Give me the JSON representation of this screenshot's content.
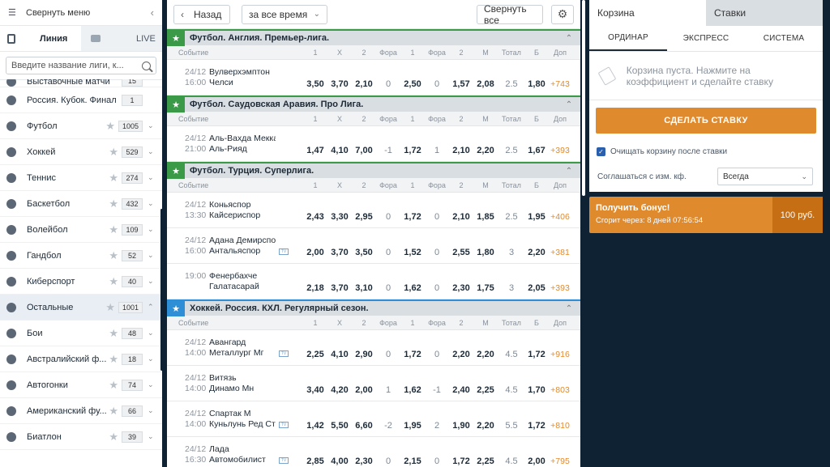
{
  "sidebar": {
    "collapse_label": "Свернуть меню",
    "tab_line": "Линия",
    "tab_live": "LIVE",
    "search_placeholder": "Введите название лиги, к...",
    "items": [
      {
        "name": "Выставочные матчи",
        "count": "15",
        "icon": "trophy-icon"
      },
      {
        "name": "Россия. Кубок. Финал",
        "count": "1",
        "icon": "trophy-icon"
      },
      {
        "name": "Футбол",
        "count": "1005",
        "icon": "soccer-ball-icon"
      },
      {
        "name": "Хоккей",
        "count": "529",
        "icon": "hockey-puck-icon"
      },
      {
        "name": "Теннис",
        "count": "274",
        "icon": "tennis-ball-icon"
      },
      {
        "name": "Баскетбол",
        "count": "432",
        "icon": "basketball-icon"
      },
      {
        "name": "Волейбол",
        "count": "109",
        "icon": "volleyball-icon"
      },
      {
        "name": "Гандбол",
        "count": "52",
        "icon": "handball-icon"
      },
      {
        "name": "Киберспорт",
        "count": "40",
        "icon": "gamepad-icon"
      },
      {
        "name": "Остальные",
        "count": "1001",
        "icon": "other-sports-icon"
      },
      {
        "name": "Бои",
        "count": "48",
        "icon": "boxing-glove-icon"
      },
      {
        "name": "Австралийский ф...",
        "count": "18",
        "icon": "aussie-football-icon"
      },
      {
        "name": "Автогонки",
        "count": "74",
        "icon": "steering-wheel-icon"
      },
      {
        "name": "Американский фу...",
        "count": "66",
        "icon": "american-football-icon"
      },
      {
        "name": "Биатлон",
        "count": "39",
        "icon": "biathlon-icon"
      }
    ]
  },
  "toolbar": {
    "back_label": "Назад",
    "time_label": "за все время",
    "collapse_all_label": "Свернуть все"
  },
  "columns": [
    "Событие",
    "1",
    "X",
    "2",
    "Фора",
    "1",
    "Фора",
    "2",
    "М",
    "Тотал",
    "Б",
    "Доп"
  ],
  "leagues": [
    {
      "name": "Футбол. Англия. Премьер-лига.",
      "accent": "#3a9a47",
      "matches": [
        {
          "date": "24/12",
          "time": "16:00",
          "team1": "Вулверхэмптон",
          "team2": "Челси",
          "tv": false,
          "odds": [
            "3,50",
            "3,70",
            "2,10",
            "0",
            "2,50",
            "0",
            "1,57",
            "2,08",
            "2.5",
            "1,80",
            "+743"
          ]
        }
      ]
    },
    {
      "name": "Футбол. Саудовская Аравия. Про Лига.",
      "accent": "#3a9a47",
      "matches": [
        {
          "date": "24/12",
          "time": "21:00",
          "team1": "Аль-Вахда Мекка",
          "team2": "Аль-Рияд",
          "tv": false,
          "odds": [
            "1,47",
            "4,10",
            "7,00",
            "-1",
            "1,72",
            "1",
            "2,10",
            "2,20",
            "2.5",
            "1,67",
            "+393"
          ]
        }
      ]
    },
    {
      "name": "Футбол. Турция. Суперлига.",
      "accent": "#3a9a47",
      "matches": [
        {
          "date": "24/12",
          "time": "13:30",
          "team1": "Коньяспор",
          "team2": "Кайсериспор",
          "tv": false,
          "odds": [
            "2,43",
            "3,30",
            "2,95",
            "0",
            "1,72",
            "0",
            "2,10",
            "1,85",
            "2.5",
            "1,95",
            "+406"
          ]
        },
        {
          "date": "24/12",
          "time": "16:00",
          "team1": "Адана Демирспор",
          "team2": "Антальяспор",
          "tv": true,
          "odds": [
            "2,00",
            "3,70",
            "3,50",
            "0",
            "1,52",
            "0",
            "2,55",
            "1,80",
            "3",
            "2,20",
            "+381"
          ]
        },
        {
          "date": "",
          "time": "19:00",
          "team1": "Фенербахче",
          "team2": "Галатасарай",
          "tv": false,
          "odds": [
            "2,18",
            "3,70",
            "3,10",
            "0",
            "1,62",
            "0",
            "2,30",
            "1,75",
            "3",
            "2,05",
            "+393"
          ]
        }
      ]
    },
    {
      "name": "Хоккей. Россия. КХЛ. Регулярный сезон.",
      "accent": "#2f8fd6",
      "matches": [
        {
          "date": "24/12",
          "time": "14:00",
          "team1": "Авангард",
          "team2": "Металлург Мг",
          "tv": true,
          "odds": [
            "2,25",
            "4,10",
            "2,90",
            "0",
            "1,72",
            "0",
            "2,20",
            "2,20",
            "4.5",
            "1,72",
            "+916"
          ]
        },
        {
          "date": "24/12",
          "time": "14:00",
          "team1": "Витязь",
          "team2": "Динамо Мн",
          "tv": false,
          "odds": [
            "3,40",
            "4,20",
            "2,00",
            "1",
            "1,62",
            "-1",
            "2,40",
            "2,25",
            "4.5",
            "1,70",
            "+803"
          ]
        },
        {
          "date": "24/12",
          "time": "14:00",
          "team1": "Спартак М",
          "team2": "Куньлунь Ред Ста",
          "tv": true,
          "odds": [
            "1,42",
            "5,50",
            "6,60",
            "-2",
            "1,95",
            "2",
            "1,90",
            "2,20",
            "5.5",
            "1,72",
            "+810"
          ]
        },
        {
          "date": "24/12",
          "time": "16:30",
          "team1": "Лада",
          "team2": "Автомобилист",
          "tv": true,
          "odds": [
            "2,85",
            "4,00",
            "2,30",
            "0",
            "2,15",
            "0",
            "1,72",
            "2,25",
            "4.5",
            "2,00",
            "+795"
          ]
        }
      ]
    }
  ],
  "cart": {
    "tab_cart": "Корзина",
    "tab_bets": "Ставки",
    "type_single": "ОРДИНАР",
    "type_express": "ЭКСПРЕСС",
    "type_system": "СИСТЕМА",
    "empty_text": "Корзина пуста. Нажмите на коэффициент и сделайте ставку",
    "make_bet_label": "СДЕЛАТЬ СТАВКУ",
    "clear_label": "Очищать корзину после ставки",
    "agree_label": "Соглашаться с изм. кф.",
    "agree_value": "Всегда"
  },
  "bonus": {
    "title": "Получить бонус!",
    "expires": "Сгорит через: 8 дней 07:56:54",
    "amount": "100 руб."
  },
  "colors": {
    "accent_orange": "#e08a2e",
    "league_green": "#3a9a47",
    "league_blue": "#2f8fd6",
    "background": "#0f2233"
  }
}
